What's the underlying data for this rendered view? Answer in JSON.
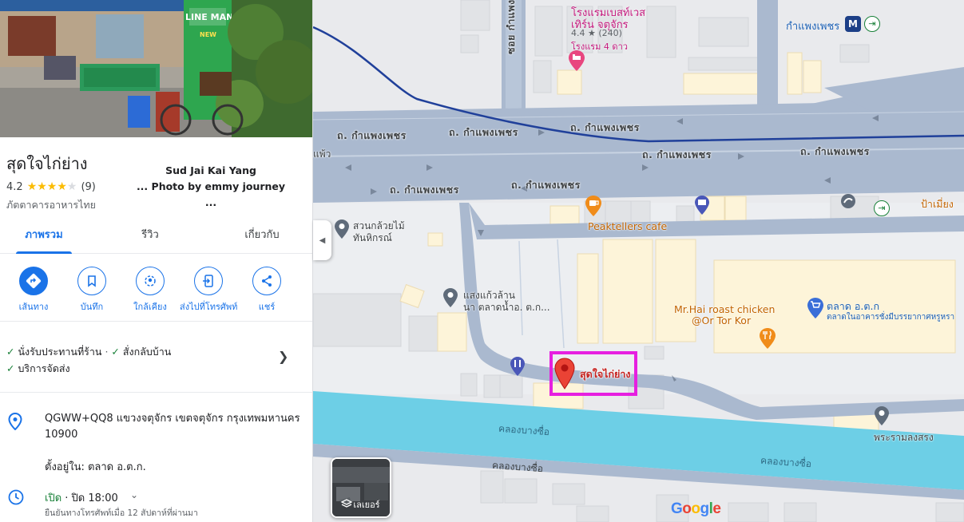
{
  "place": {
    "name": "สุดใจไก่ย่าง",
    "photo_credit_line1": "Sud Jai Kai Yang",
    "photo_credit_line2": "... Photo by emmy journey ...",
    "rating": "4.2",
    "stars_shown": 4,
    "reviews": "(9)",
    "category": "ภัตตาคารอาหารไทย"
  },
  "tabs": [
    {
      "label": "ภาพรวม",
      "active": true
    },
    {
      "label": "รีวิว",
      "active": false
    },
    {
      "label": "เกี่ยวกับ",
      "active": false
    }
  ],
  "actions": [
    {
      "label": "เส้นทาง",
      "icon": "directions-icon"
    },
    {
      "label": "บันทึก",
      "icon": "bookmark-icon"
    },
    {
      "label": "ใกล้เคียง",
      "icon": "nearby-icon"
    },
    {
      "label": "ส่งไปที่โทรศัพท์",
      "icon": "send-to-phone-icon"
    },
    {
      "label": "แชร์",
      "icon": "share-icon"
    }
  ],
  "services": {
    "dine_in": "นั่งรับประทานที่ร้าน",
    "separator": "·",
    "takeout": "สั่งกลับบ้าน",
    "delivery": "บริการจัดส่ง"
  },
  "details": {
    "address": "QGWW+QQ8 แขวงจตุจักร เขตจตุจักร กรุงเทพมหานคร 10900",
    "located_in": "ตั้งอยู่ใน: ตลาด อ.ต.ก.",
    "hours_status": "เปิด",
    "hours_close": " · ปิด 18:00",
    "hours_note": "ยืนยันทางโทรศัพท์เมื่อ 12 สัปดาห์ที่ผ่านมา"
  },
  "hero_sign": {
    "line1": "LINE MAN",
    "line2": "NEW"
  },
  "map": {
    "roads": {
      "kamphaeng_phet": "ถ. กำแพงเพชร",
      "soi": "ซอย กำแพงเพชร 1",
      "canal": "คลองบางซื่อ"
    },
    "labels": {
      "hotel_name_1": "โรงแรมเบสท์เวส",
      "hotel_name_2": "เทิร์น จตุจักร",
      "hotel_rating": "4.4 ★ (240)",
      "hotel_type": "โรงแรม 4 ดาว",
      "station": "กำแพงเพชร",
      "station_badge": "M",
      "garden_1": "สวนกล้วยไม้",
      "garden_2": "ทันหิกรณ์",
      "peaktellers": "Peaktellers cafe",
      "pamuang": "ป้าเมี่ยง",
      "sangkaew_1": "แสงแก้วล้าน",
      "sangkaew_2": "นา ตลาดน้ำอ. ต.ก...",
      "mrhai_1": "Mr.Hai roast chicken",
      "mrhai_2": "@Or Tor Kor",
      "market_name": "ตลาด อ.ต.ก",
      "market_sub": "ตลาดในอาคารชั่งมีบรรยากาศหรูหรา",
      "pin": "สุดใจไก่ย่าง",
      "praram": "พระรามลงสรง",
      "edge_left": "แพ้ว",
      "layers": "เลเยอร์",
      "google": "Google"
    }
  },
  "colors": {
    "accent": "#1a73e8",
    "highlight": "#e61fe0",
    "canal": "#6dcfe6",
    "road": "#aab9cf",
    "building": "#fdf4d9",
    "pin": "#ea4335"
  }
}
